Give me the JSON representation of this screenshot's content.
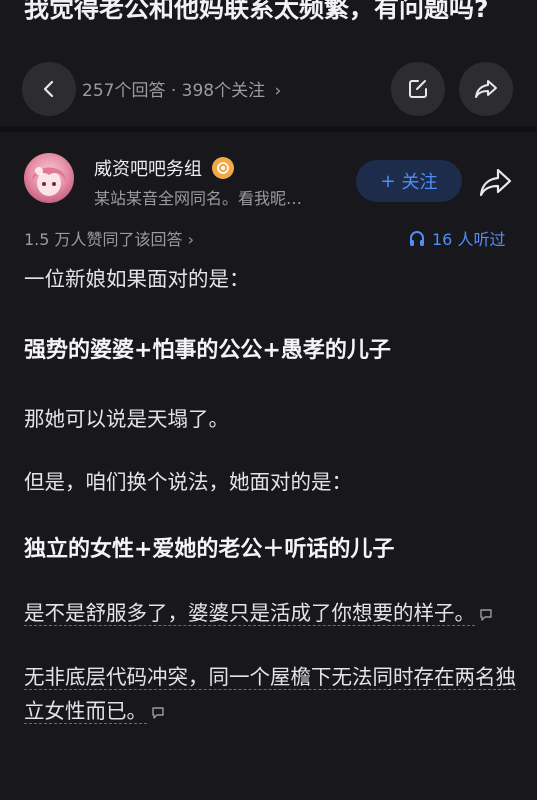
{
  "question": {
    "title": "我觉得老公和他妈联系太频繁，有问题吗?",
    "answers_count": "257个回答",
    "separator": "·",
    "followers_count": "398个关注",
    "chevron": "›"
  },
  "actions": {
    "back_icon": "chevron-left-icon",
    "edit_icon": "edit-icon",
    "share_icon": "share-icon"
  },
  "author": {
    "name": "威资吧吧务组",
    "bio": "某站某音全网同名。看我昵…",
    "follow_plus": "+",
    "follow_label": "关注"
  },
  "stats": {
    "likes": "1.5 万人赞同了该回答",
    "likes_chevron": "›",
    "listeners": "16 人听过"
  },
  "answer": {
    "p1": "一位新娘如果面对的是：",
    "h1": "强势的婆婆+怕事的公公+愚孝的儿子",
    "p2": "那她可以说是天塌了。",
    "p3": "但是，咱们换个说法，她面对的是：",
    "h2": "独立的女性+爱她的老公＋听话的儿子",
    "p4": "是不是舒服多了，婆婆只是活成了你想要的样子。",
    "p5": "无非底层代码冲突，同一个屋檐下无法同时存在两名独立女性而已。"
  },
  "colors": {
    "background": "#18181c",
    "accent": "#4f8ef7",
    "muted": "#9a9aa0",
    "badge": "#f3a847"
  }
}
